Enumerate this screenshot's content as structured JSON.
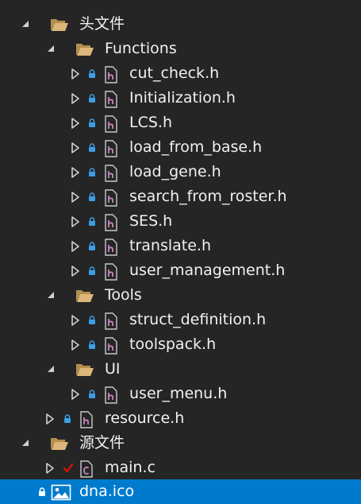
{
  "tree": [
    {
      "label": "头文件",
      "kind": "folder",
      "expand": "expanded",
      "state": ""
    },
    {
      "label": "Functions",
      "kind": "folder",
      "expand": "expanded",
      "state": ""
    },
    {
      "label": "cut_check.h",
      "kind": "header",
      "expand": "collapsed",
      "state": "locked"
    },
    {
      "label": "Initialization.h",
      "kind": "header",
      "expand": "collapsed",
      "state": "locked"
    },
    {
      "label": "LCS.h",
      "kind": "header",
      "expand": "collapsed",
      "state": "locked"
    },
    {
      "label": "load_from_base.h",
      "kind": "header",
      "expand": "collapsed",
      "state": "locked"
    },
    {
      "label": "load_gene.h",
      "kind": "header",
      "expand": "collapsed",
      "state": "locked"
    },
    {
      "label": "search_from_roster.h",
      "kind": "header",
      "expand": "collapsed",
      "state": "locked"
    },
    {
      "label": "SES.h",
      "kind": "header",
      "expand": "collapsed",
      "state": "locked"
    },
    {
      "label": "translate.h",
      "kind": "header",
      "expand": "collapsed",
      "state": "locked"
    },
    {
      "label": "user_management.h",
      "kind": "header",
      "expand": "collapsed",
      "state": "locked"
    },
    {
      "label": "Tools",
      "kind": "folder",
      "expand": "expanded",
      "state": ""
    },
    {
      "label": "struct_definition.h",
      "kind": "header",
      "expand": "collapsed",
      "state": "locked"
    },
    {
      "label": "toolspack.h",
      "kind": "header",
      "expand": "collapsed",
      "state": "locked"
    },
    {
      "label": "UI",
      "kind": "folder",
      "expand": "expanded",
      "state": ""
    },
    {
      "label": "user_menu.h",
      "kind": "header",
      "expand": "collapsed",
      "state": "locked"
    },
    {
      "label": "resource.h",
      "kind": "header",
      "expand": "collapsed",
      "state": "locked"
    },
    {
      "label": "源文件",
      "kind": "folder",
      "expand": "expanded",
      "state": ""
    },
    {
      "label": "main.c",
      "kind": "c-source",
      "expand": "collapsed",
      "state": "modified"
    },
    {
      "label": "dna.ico",
      "kind": "image",
      "expand": "none",
      "state": "locked",
      "selected": true
    }
  ],
  "colors": {
    "background": "#252526",
    "selection": "#007acc",
    "folder": "#dcb67a",
    "lock": "#3a9fe6",
    "check": "#e51400",
    "header_icon": "#c586c0"
  },
  "icons": {
    "folder": "folder-open-icon",
    "header": "header-file-icon",
    "c-source": "c-source-file-icon",
    "image": "image-file-icon",
    "expanded": "expanded-triangle-icon",
    "collapsed": "collapsed-triangle-icon",
    "locked": "lock-icon",
    "modified": "checkmark-icon"
  }
}
